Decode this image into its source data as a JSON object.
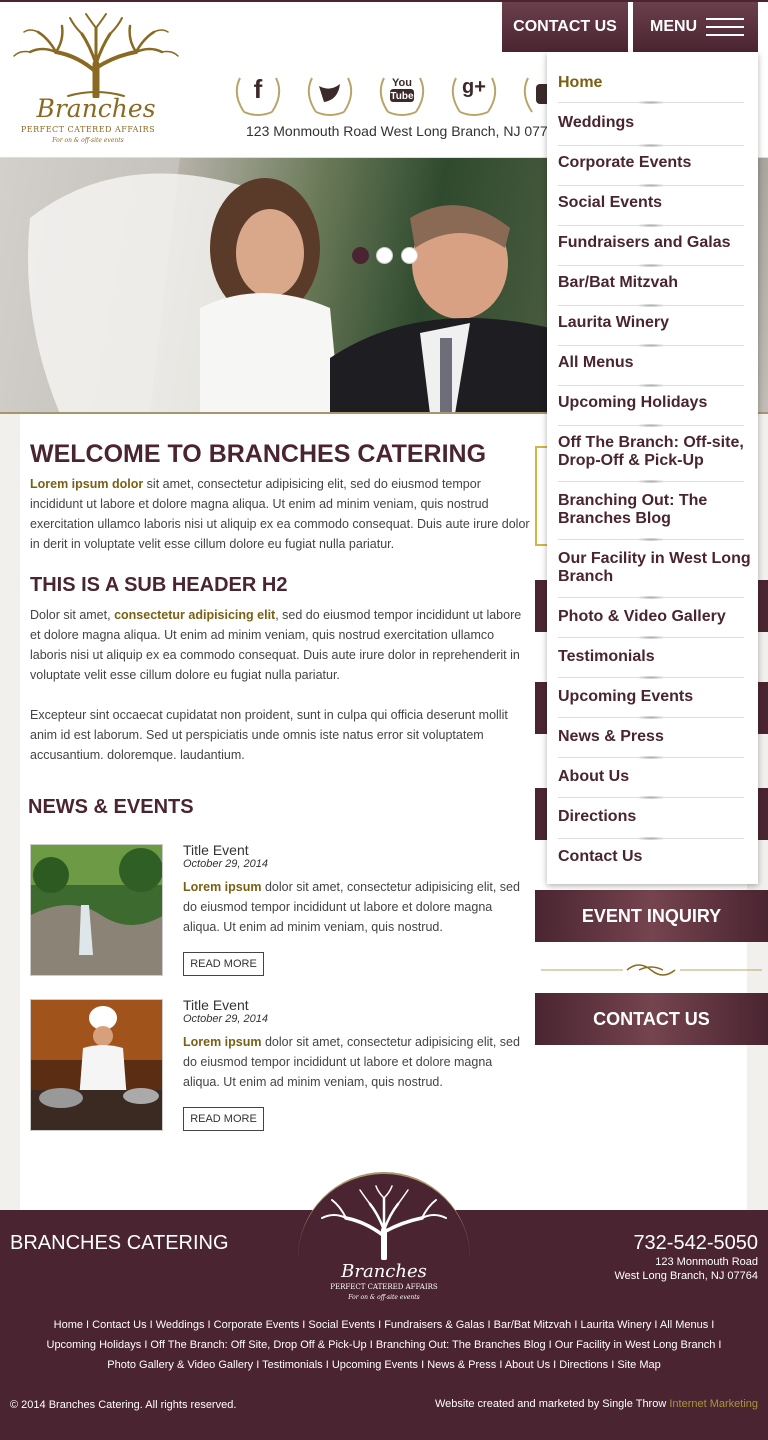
{
  "header": {
    "logo_brand": "Branches",
    "logo_tagline": "PERFECT CATERED AFFAIRS",
    "logo_sub": "For on & off-site events",
    "address": "123 Monmouth Road West Long Branch, NJ 077",
    "contact_label": "CONTACT US",
    "menu_label": "MENU",
    "social": [
      {
        "icon": "facebook-icon",
        "glyph": "f"
      },
      {
        "icon": "twitter-icon",
        "glyph": "t"
      },
      {
        "icon": "youtube-icon",
        "glyph": "You\nTube"
      },
      {
        "icon": "google-plus-icon",
        "glyph": "g+"
      },
      {
        "icon": "instagram-icon",
        "glyph": "ig"
      }
    ]
  },
  "menu": {
    "items": [
      "Home",
      "Weddings",
      "Corporate Events",
      "Social Events",
      "Fundraisers and Galas",
      "Bar/Bat Mitzvah",
      "Laurita Winery",
      "All Menus",
      "Upcoming Holidays",
      "Off The Branch: Off-site, Drop-Off & Pick-Up",
      "Branching Out: The Branches Blog",
      "Our Facility in West Long Branch",
      "Photo & Video Gallery",
      "Testimonials",
      "Upcoming Events",
      "News & Press",
      "About Us",
      "Directions",
      "Contact Us"
    ]
  },
  "content": {
    "title": "WELCOME TO BRANCHES CATERING",
    "intro_bold": "Lorem ipsum dolor",
    "intro_text": " sit amet, consectetur adipisicing elit, sed do eiusmod tempor incididunt ut labore et dolore magna aliqua. Ut enim ad minim veniam, quis nostrud exercitation ullamco laboris nisi ut aliquip ex ea commodo consequat. Duis aute irure dolor in derit in voluptate velit esse cillum dolore eu fugiat nulla pariatur.",
    "subheader": "THIS IS A SUB HEADER H2",
    "p2_start": "Dolor sit amet, ",
    "p2_bold": "consectetur adipisicing elit",
    "p2_text": ", sed do eiusmod tempor incididunt ut labore et dolore magna aliqua. Ut enim ad minim veniam, quis nostrud exercitation ullamco laboris nisi ut aliquip ex ea commodo consequat. Duis aute irure dolor in reprehenderit in voluptate velit esse cillum dolore eu fugiat nulla pariatur.",
    "p3": "Excepteur sint occaecat cupidatat non proident, sunt in culpa qui officia deserunt mollit anim id est laborum. Sed ut perspiciatis unde omnis iste natus error sit voluptatem accusantium. doloremque. laudantium.",
    "news_title": "NEWS & EVENTS",
    "events": [
      {
        "title": "Title Event",
        "date": "October 29, 2014",
        "bold": "Lorem ipsum",
        "text": " dolor sit amet, consectetur adipisicing elit, sed do eiusmod tempor incididunt ut labore et dolore magna aliqua. Ut enim ad minim veniam, quis nostrud.",
        "button": "READ MORE"
      },
      {
        "title": "Title Event",
        "date": "October 29, 2014",
        "bold": "Lorem ipsum",
        "text": " dolor sit amet, consectetur adipisicing elit, sed do eiusmod tempor incididunt ut labore et dolore magna aliqua. Ut enim ad minim veniam, quis nostrud.",
        "button": "READ MORE"
      }
    ]
  },
  "sidebar": {
    "event_inquiry": "EVENT INQUIRY",
    "contact_us": "CONTACT US"
  },
  "footer": {
    "name": "BRANCHES CATERING",
    "phone": "732-542-5050",
    "address_line1": "123 Monmouth Road",
    "address_line2": "West Long Branch, NJ 07764",
    "logo_brand": "Branches",
    "logo_tagline": "PERFECT CATERED AFFAIRS",
    "logo_sub": "For on & off-site events",
    "links_line1": "Home I Contact Us I Weddings I Corporate Events I Social Events I Fundraisers & Galas I Bar/Bat Mitzvah I Laurita Winery I All Menus I",
    "links_line2": "Upcoming Holidays I Off The Branch: Off Site, Drop Off & Pick-Up I Branching Out: The Branches Blog I Our Facility in West Long Branch I",
    "links_line3": "Photo Gallery & Video Gallery I Testimonials I Upcoming Events I News & Press I About Us I Directions I Site Map",
    "copyright": "© 2014 Branches Catering. All rights reserved.",
    "credit_prefix": "Website created and marketed by Single Throw ",
    "credit_link": "Internet Marketing"
  },
  "colors": {
    "brand": "#4a2531",
    "accent_gold": "#7a6014",
    "footer_link_accent": "#a9953c"
  },
  "hero": {
    "slide_count": 3,
    "active_slide": 1
  }
}
